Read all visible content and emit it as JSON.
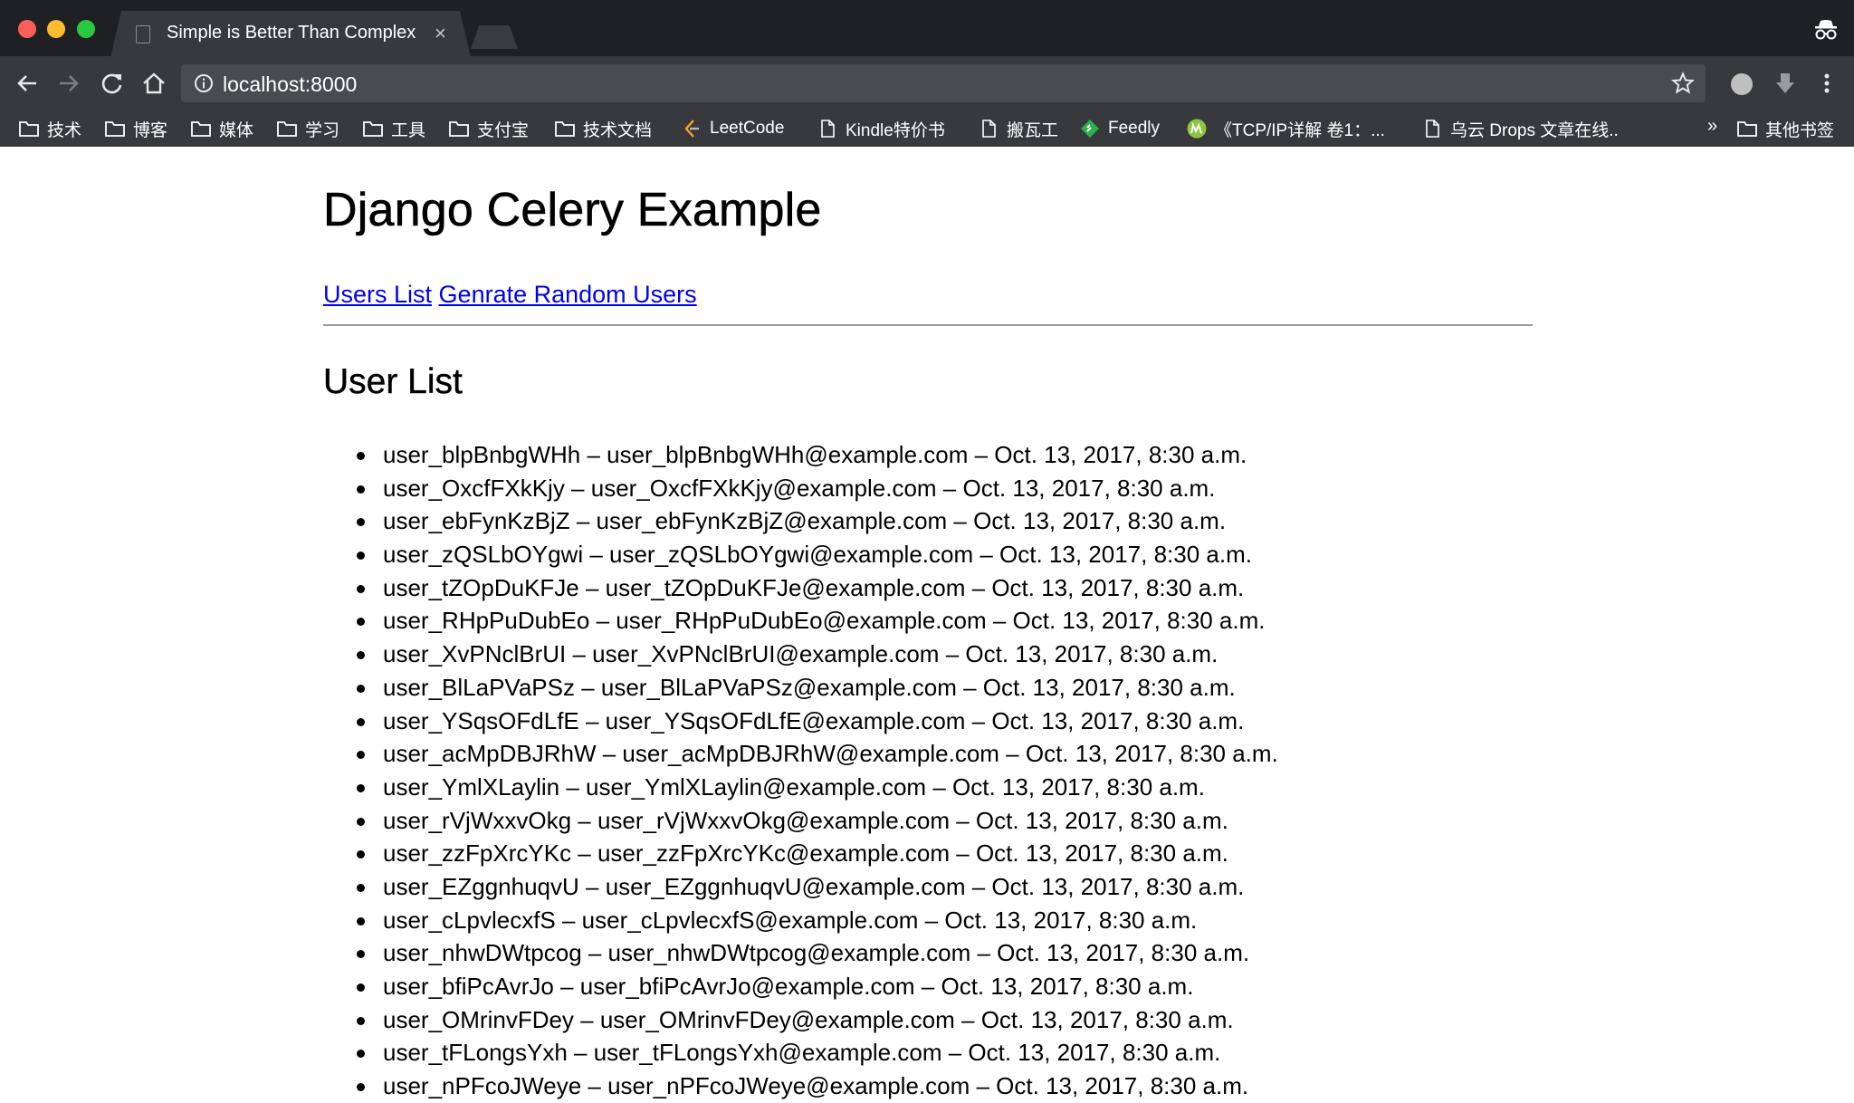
{
  "browser": {
    "tab_title": "Simple is Better Than Complex",
    "tab_close": "×",
    "url": "localhost:8000",
    "bookmarks_more": "»",
    "bookmarks": [
      {
        "label": "技术",
        "icon": "folder-icon"
      },
      {
        "label": "博客",
        "icon": "folder-icon"
      },
      {
        "label": "媒体",
        "icon": "folder-icon"
      },
      {
        "label": "学习",
        "icon": "folder-icon"
      },
      {
        "label": "工具",
        "icon": "folder-icon"
      },
      {
        "label": "支付宝",
        "icon": "folder-icon"
      },
      {
        "label": "技术文档",
        "icon": "folder-icon"
      },
      {
        "label": "LeetCode",
        "icon": "leetcode-icon"
      },
      {
        "label": "Kindle特价书",
        "icon": "page-icon"
      },
      {
        "label": "搬瓦工",
        "icon": "page-icon"
      },
      {
        "label": "Feedly",
        "icon": "feedly-icon"
      },
      {
        "label": "《TCP/IP详解 卷1：...",
        "icon": "m-icon"
      },
      {
        "label": "乌云 Drops 文章在线..",
        "icon": "page-icon"
      }
    ],
    "other_bookmarks": "其他书签"
  },
  "page": {
    "title": "Django Celery Example",
    "nav": {
      "users_list": "Users List",
      "generate": "Genrate Random Users"
    },
    "section_title": "User List",
    "users": [
      "user_blpBnbgWHh – user_blpBnbgWHh@example.com – Oct. 13, 2017, 8:30 a.m.",
      "user_OxcfFXkKjy – user_OxcfFXkKjy@example.com – Oct. 13, 2017, 8:30 a.m.",
      "user_ebFynKzBjZ – user_ebFynKzBjZ@example.com – Oct. 13, 2017, 8:30 a.m.",
      "user_zQSLbOYgwi – user_zQSLbOYgwi@example.com – Oct. 13, 2017, 8:30 a.m.",
      "user_tZOpDuKFJe – user_tZOpDuKFJe@example.com – Oct. 13, 2017, 8:30 a.m.",
      "user_RHpPuDubEo – user_RHpPuDubEo@example.com – Oct. 13, 2017, 8:30 a.m.",
      "user_XvPNclBrUI – user_XvPNclBrUI@example.com – Oct. 13, 2017, 8:30 a.m.",
      "user_BlLaPVaPSz – user_BlLaPVaPSz@example.com – Oct. 13, 2017, 8:30 a.m.",
      "user_YSqsOFdLfE – user_YSqsOFdLfE@example.com – Oct. 13, 2017, 8:30 a.m.",
      "user_acMpDBJRhW – user_acMpDBJRhW@example.com – Oct. 13, 2017, 8:30 a.m.",
      "user_YmlXLaylin – user_YmlXLaylin@example.com – Oct. 13, 2017, 8:30 a.m.",
      "user_rVjWxxvOkg – user_rVjWxxvOkg@example.com – Oct. 13, 2017, 8:30 a.m.",
      "user_zzFpXrcYKc – user_zzFpXrcYKc@example.com – Oct. 13, 2017, 8:30 a.m.",
      "user_EZggnhuqvU – user_EZggnhuqvU@example.com – Oct. 13, 2017, 8:30 a.m.",
      "user_cLpvlecxfS – user_cLpvlecxfS@example.com – Oct. 13, 2017, 8:30 a.m.",
      "user_nhwDWtpcog – user_nhwDWtpcog@example.com – Oct. 13, 2017, 8:30 a.m.",
      "user_bfiPcAvrJo – user_bfiPcAvrJo@example.com – Oct. 13, 2017, 8:30 a.m.",
      "user_OMrinvFDey – user_OMrinvFDey@example.com – Oct. 13, 2017, 8:30 a.m.",
      "user_tFLongsYxh – user_tFLongsYxh@example.com – Oct. 13, 2017, 8:30 a.m.",
      "user_nPFcoJWeye – user_nPFcoJWeye@example.com – Oct. 13, 2017, 8:30 a.m."
    ]
  }
}
